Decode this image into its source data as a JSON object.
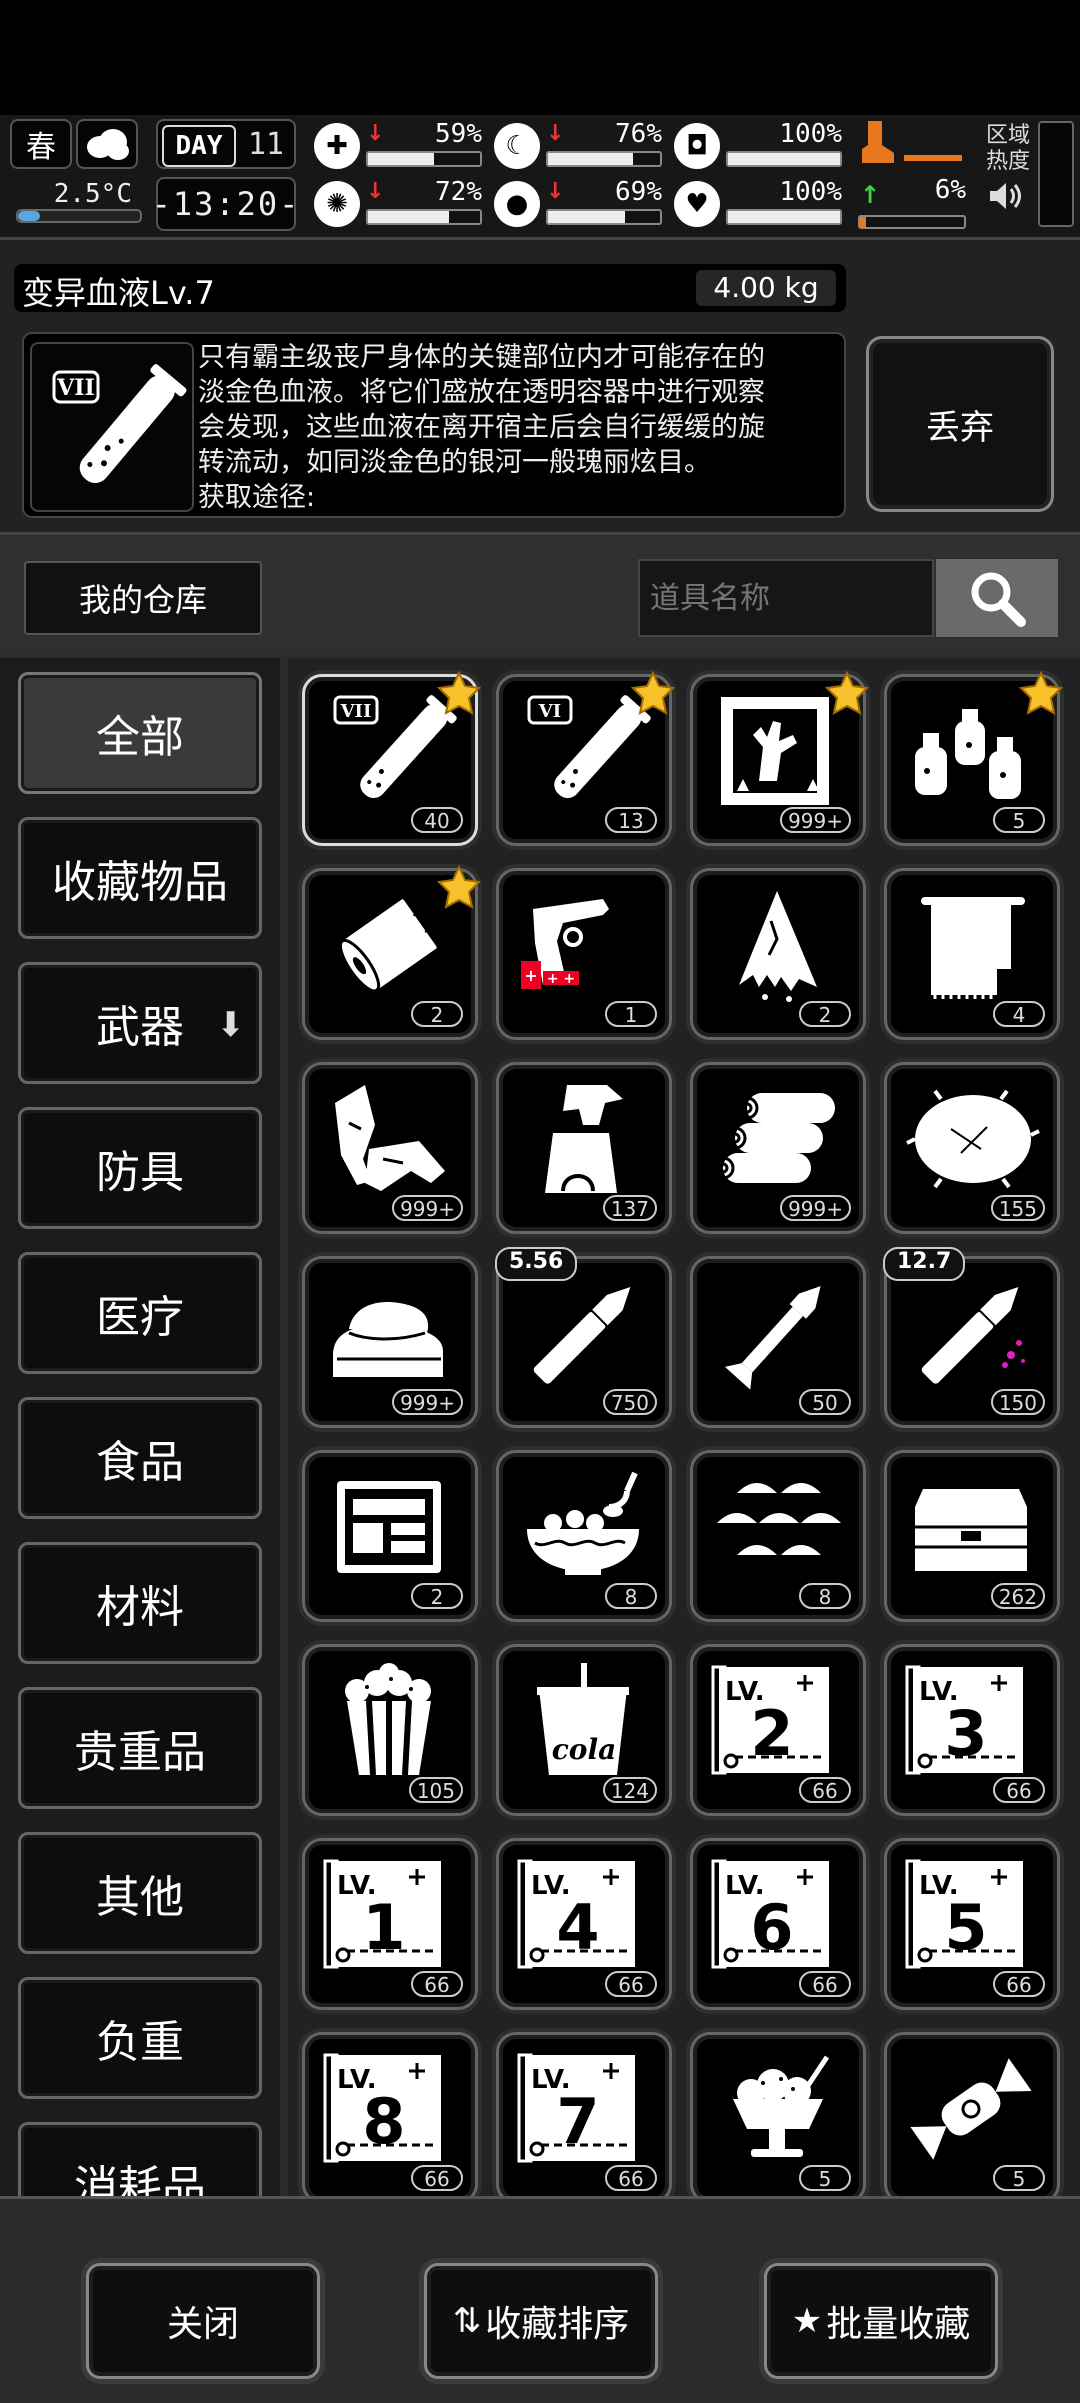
{
  "hud": {
    "season": "春",
    "weather_icon": "cloud-icon",
    "temperature": "2.5°C",
    "temp_level": 0.18,
    "day_label": "DAY",
    "day_value": "11",
    "time": "-13:20-",
    "stats": [
      {
        "name": "health",
        "icon": "medkit-icon",
        "trend": "down",
        "percent": "59%",
        "level": 0.59
      },
      {
        "name": "hunger",
        "icon": "stomach-icon",
        "trend": "down",
        "percent": "76%",
        "level": 0.76
      },
      {
        "name": "armor",
        "icon": "armor-icon",
        "trend": "",
        "percent": "100%",
        "level": 1.0
      },
      {
        "name": "sanity",
        "icon": "brain-icon",
        "trend": "down",
        "percent": "72%",
        "level": 0.72
      },
      {
        "name": "thirst",
        "icon": "water-drop-icon",
        "trend": "down",
        "percent": "69%",
        "level": 0.69
      },
      {
        "name": "mood",
        "icon": "heart-icon",
        "trend": "",
        "percent": "100%",
        "level": 1.0
      }
    ],
    "stamina": {
      "icon": "boot-icon",
      "trend": "up",
      "percent": "6%",
      "level": 0.06
    },
    "region_label_1": "区域",
    "region_label_2": "热度"
  },
  "detail": {
    "item_name": "变异血液Lv.7",
    "weight": "4.00 kg",
    "description_lines": [
      "只有霸主级丧尸身体的关键部位内才可能存在的",
      "淡金色血液。将它们盛放在透明容器中进行观察",
      "会发现，这些血液在离开宿主后会自行缓缓的旋",
      "转流动，如同淡金色的银河一般瑰丽炫目。",
      "获取途径:"
    ],
    "icon_numeral": "VII",
    "discard_label": "丢弃"
  },
  "warehouse": {
    "title": "我的仓库",
    "search_placeholder": "道具名称"
  },
  "categories": [
    {
      "label": "全部",
      "active": true
    },
    {
      "label": "收藏物品"
    },
    {
      "label": "武器"
    },
    {
      "label": "防具"
    },
    {
      "label": "医疗"
    },
    {
      "label": "食品"
    },
    {
      "label": "材料"
    },
    {
      "label": "贵重品"
    },
    {
      "label": "其他"
    },
    {
      "label": "负重"
    },
    {
      "label": "消耗品"
    }
  ],
  "items": [
    {
      "icon": "blood-vial-vii-icon",
      "count": "40",
      "fav": true,
      "selected": true,
      "numeral": "VII"
    },
    {
      "icon": "blood-vial-vi-icon",
      "count": "13",
      "fav": true,
      "numeral": "VI"
    },
    {
      "icon": "zombie-poster-icon",
      "count": "999+",
      "fav": true
    },
    {
      "icon": "bottles-icon",
      "count": "5",
      "fav": true
    },
    {
      "icon": "paper-roll-icon",
      "count": "2",
      "fav": true
    },
    {
      "icon": "flare-gun-icon",
      "count": "1"
    },
    {
      "icon": "torn-cloth-icon",
      "count": "2"
    },
    {
      "icon": "towel-icon",
      "count": "4"
    },
    {
      "icon": "rags-icon",
      "count": "999+"
    },
    {
      "icon": "spray-bottle-icon",
      "count": "137"
    },
    {
      "icon": "logs-icon",
      "count": "999+"
    },
    {
      "icon": "cotton-icon",
      "count": "155"
    },
    {
      "icon": "cloth-pile-icon",
      "count": "999+"
    },
    {
      "icon": "bullet-icon",
      "count": "750",
      "caliber": "5.56"
    },
    {
      "icon": "rocket-icon",
      "count": "50"
    },
    {
      "icon": "bullet-icon",
      "count": "150",
      "caliber": "12.7"
    },
    {
      "icon": "toolbox-icon",
      "count": "2"
    },
    {
      "icon": "food-bowl-icon",
      "count": "8"
    },
    {
      "icon": "dumplings-icon",
      "count": "8"
    },
    {
      "icon": "tool-chest-icon",
      "count": "262"
    },
    {
      "icon": "popcorn-icon",
      "count": "105"
    },
    {
      "icon": "cola-cup-icon",
      "count": "124",
      "text": "cola"
    },
    {
      "icon": "skill-book-icon",
      "count": "66",
      "lv": "LV.",
      "num": "2"
    },
    {
      "icon": "skill-book-icon",
      "count": "66",
      "lv": "LV.",
      "num": "3"
    },
    {
      "icon": "skill-book-icon",
      "count": "66",
      "lv": "LV.",
      "num": "1"
    },
    {
      "icon": "skill-book-icon",
      "count": "66",
      "lv": "LV.",
      "num": "4"
    },
    {
      "icon": "skill-book-icon",
      "count": "66",
      "lv": "LV.",
      "num": "6"
    },
    {
      "icon": "skill-book-icon",
      "count": "66",
      "lv": "LV.",
      "num": "5"
    },
    {
      "icon": "skill-book-icon",
      "count": "66",
      "lv": "LV.",
      "num": "8"
    },
    {
      "icon": "skill-book-icon",
      "count": "66",
      "lv": "LV.",
      "num": "7"
    },
    {
      "icon": "ice-cream-icon",
      "count": "5"
    },
    {
      "icon": "candy-icon",
      "count": "5"
    }
  ],
  "bottom": {
    "close_label": "关闭",
    "sort_label": "收藏排序",
    "batch_label": "批量收藏"
  }
}
